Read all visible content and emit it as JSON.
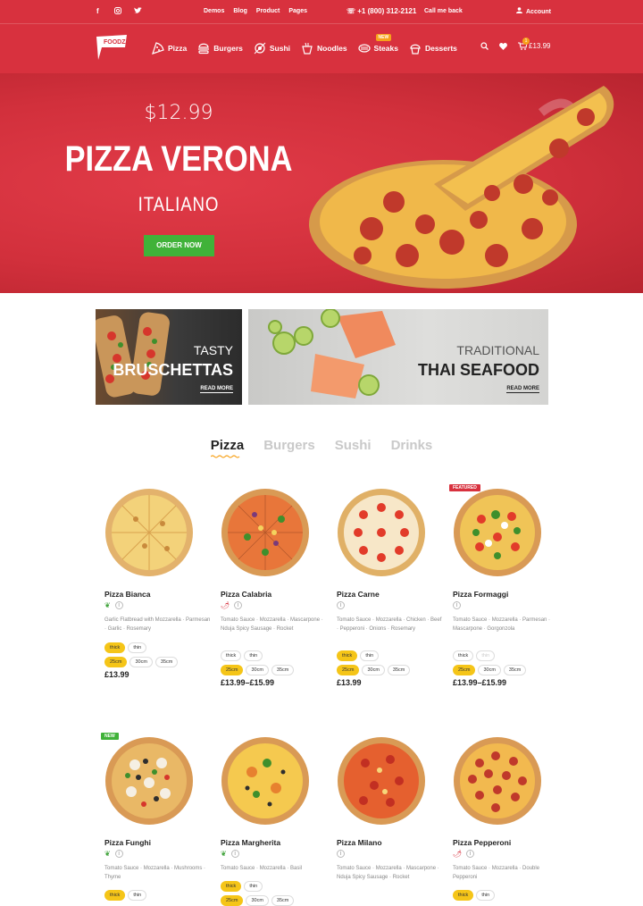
{
  "topbar": {
    "links": [
      "Demos",
      "Blog",
      "Product",
      "Pages"
    ],
    "phone": "+1 (800) 312-2121",
    "call": "Call me back",
    "account": "Account"
  },
  "nav": {
    "logo": "FOODZ",
    "items": [
      {
        "label": "Pizza",
        "icon": "pizza-icon"
      },
      {
        "label": "Burgers",
        "icon": "burger-icon"
      },
      {
        "label": "Sushi",
        "icon": "sushi-icon"
      },
      {
        "label": "Noodles",
        "icon": "noodles-icon"
      },
      {
        "label": "Steaks",
        "icon": "steak-icon",
        "badge": "NEW"
      },
      {
        "label": "Desserts",
        "icon": "cupcake-icon"
      }
    ],
    "cart_count": "1",
    "cart_total": "£13.99"
  },
  "hero": {
    "price": "$12.99",
    "title": "PIZZA VERONA",
    "subtitle": "ITALIANO",
    "button": "ORDER NOW"
  },
  "banners": [
    {
      "small": "TASTY",
      "big": "BRUSCHETTAS",
      "more": "READ MORE"
    },
    {
      "small": "TRADITIONAL",
      "big": "THAI SEAFOOD",
      "more": "READ MORE"
    }
  ],
  "tabs": [
    "Pizza",
    "Burgers",
    "Sushi",
    "Drinks"
  ],
  "products": [
    {
      "name": "Pizza Bianca",
      "desc": "Garlic Flatbread with Mozzarella · Parmesan · Garlic · Rosemary",
      "price": "£13.99",
      "tag": ""
    },
    {
      "name": "Pizza Calabria",
      "desc": "Tomato Sauce · Mozzarella · Mascarpone · Nduja Spicy Sausage · Rocket",
      "price": "£13.99–£15.99",
      "tag": ""
    },
    {
      "name": "Pizza Carne",
      "desc": "Tomato Sauce · Mozzarella · Chicken · Beef · Pepperoni · Onions · Rosemary",
      "price": "£13.99",
      "tag": ""
    },
    {
      "name": "Pizza Formaggi",
      "desc": "Tomato Sauce · Mozzarella · Parmesan · Mascarpone · Gorgonzola",
      "price": "£13.99–£15.99",
      "tag": "FEATURED"
    },
    {
      "name": "Pizza Funghi",
      "desc": "Tomato Sauce · Mozzarella · Mushrooms · Thyme",
      "price": "",
      "tag": "NEW"
    },
    {
      "name": "Pizza Margherita",
      "desc": "Tomato Sauce · Mozzarella · Basil",
      "price": "",
      "tag": ""
    },
    {
      "name": "Pizza Milano",
      "desc": "Tomato Sauce · Mozzarella · Mascarpone · Nduja Spicy Sausage · Rocket",
      "price": "",
      "tag": ""
    },
    {
      "name": "Pizza Pepperoni",
      "desc": "Tomato Sauce · Mozzarella · Double Pepperoni",
      "price": "",
      "tag": ""
    }
  ],
  "options": {
    "crust": [
      "thick",
      "thin"
    ],
    "size": [
      "25cm",
      "30cm",
      "35cm"
    ]
  },
  "colors": {
    "brand": "#d8313e",
    "accent": "#f5c518",
    "green": "#40b239"
  }
}
